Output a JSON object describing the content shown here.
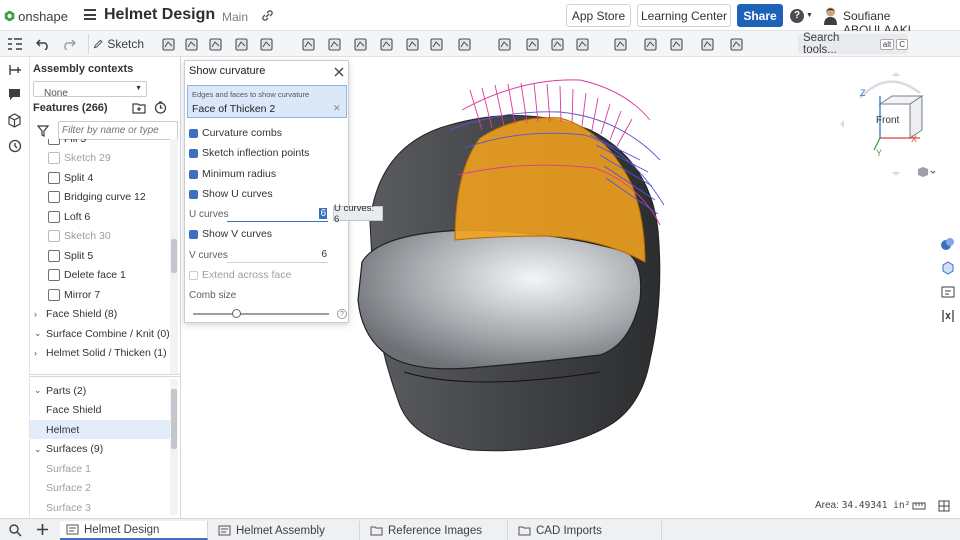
{
  "app": {
    "logo_text": "onshape",
    "doc_title": "Helmet Design",
    "branch": "Main"
  },
  "header": {
    "app_store": "App Store",
    "learning_center": "Learning Center",
    "share": "Share",
    "help": "?",
    "user": "Soufiane ABOULAAKL"
  },
  "toolbar": {
    "sketch": "Sketch",
    "search_tools": "Search tools...",
    "shortcut_1": "alt",
    "shortcut_2": "C"
  },
  "feature_panel": {
    "contexts_title": "Assembly contexts",
    "contexts_select": "None",
    "features_title": "Features (266)",
    "filter_placeholder": "Filter by name or type",
    "items": [
      {
        "label": "Fill 5",
        "muted": false
      },
      {
        "label": "Sketch 29",
        "muted": true
      },
      {
        "label": "Split 4",
        "muted": false
      },
      {
        "label": "Bridging curve 12",
        "muted": false
      },
      {
        "label": "Loft 6",
        "muted": false
      },
      {
        "label": "Sketch 30",
        "muted": true
      },
      {
        "label": "Split 5",
        "muted": false
      },
      {
        "label": "Delete face 1",
        "muted": false
      },
      {
        "label": "Mirror 7",
        "muted": false
      }
    ],
    "folders": [
      {
        "label": "Face Shield (8)",
        "expanded": false
      },
      {
        "label": "Surface Combine / Knit (0)",
        "expanded": true
      },
      {
        "label": "Helmet Solid / Thicken (1)",
        "expanded": false
      }
    ],
    "parts_title": "Parts (2)",
    "parts": [
      "Face Shield",
      "Helmet"
    ],
    "surfaces_title": "Surfaces (9)",
    "surfaces": [
      "Surface 1",
      "Surface 2",
      "Surface 3"
    ]
  },
  "dialog": {
    "title": "Show curvature",
    "selection_label": "Edges and faces to show curvature",
    "selection_value": "Face of Thicken 2",
    "curvature_combs": "Curvature combs",
    "sketch_inflection": "Sketch inflection points",
    "minimum_radius": "Minimum radius",
    "show_u": "Show U curves",
    "u_curves_label": "U curves",
    "u_curves_value": "6",
    "tooltip": "U curves: 6",
    "show_v": "Show V curves",
    "v_curves_label": "V curves",
    "v_curves_value": "6",
    "extend_across": "Extend across face",
    "comb_size": "Comb size",
    "comb_size_value": 0.32
  },
  "viewcube": {
    "front": "Front",
    "axis_x": "X",
    "axis_y": "Y",
    "axis_z": "Z"
  },
  "status": {
    "area_label": "Area:",
    "area_value": "34.49341 in²"
  },
  "tabs": [
    "Helmet Design",
    "Helmet Assembly",
    "Reference Images",
    "CAD Imports"
  ],
  "colors": {
    "accent": "#3c6fbf",
    "share": "#1f63b8",
    "surface": "#f2a21c"
  }
}
